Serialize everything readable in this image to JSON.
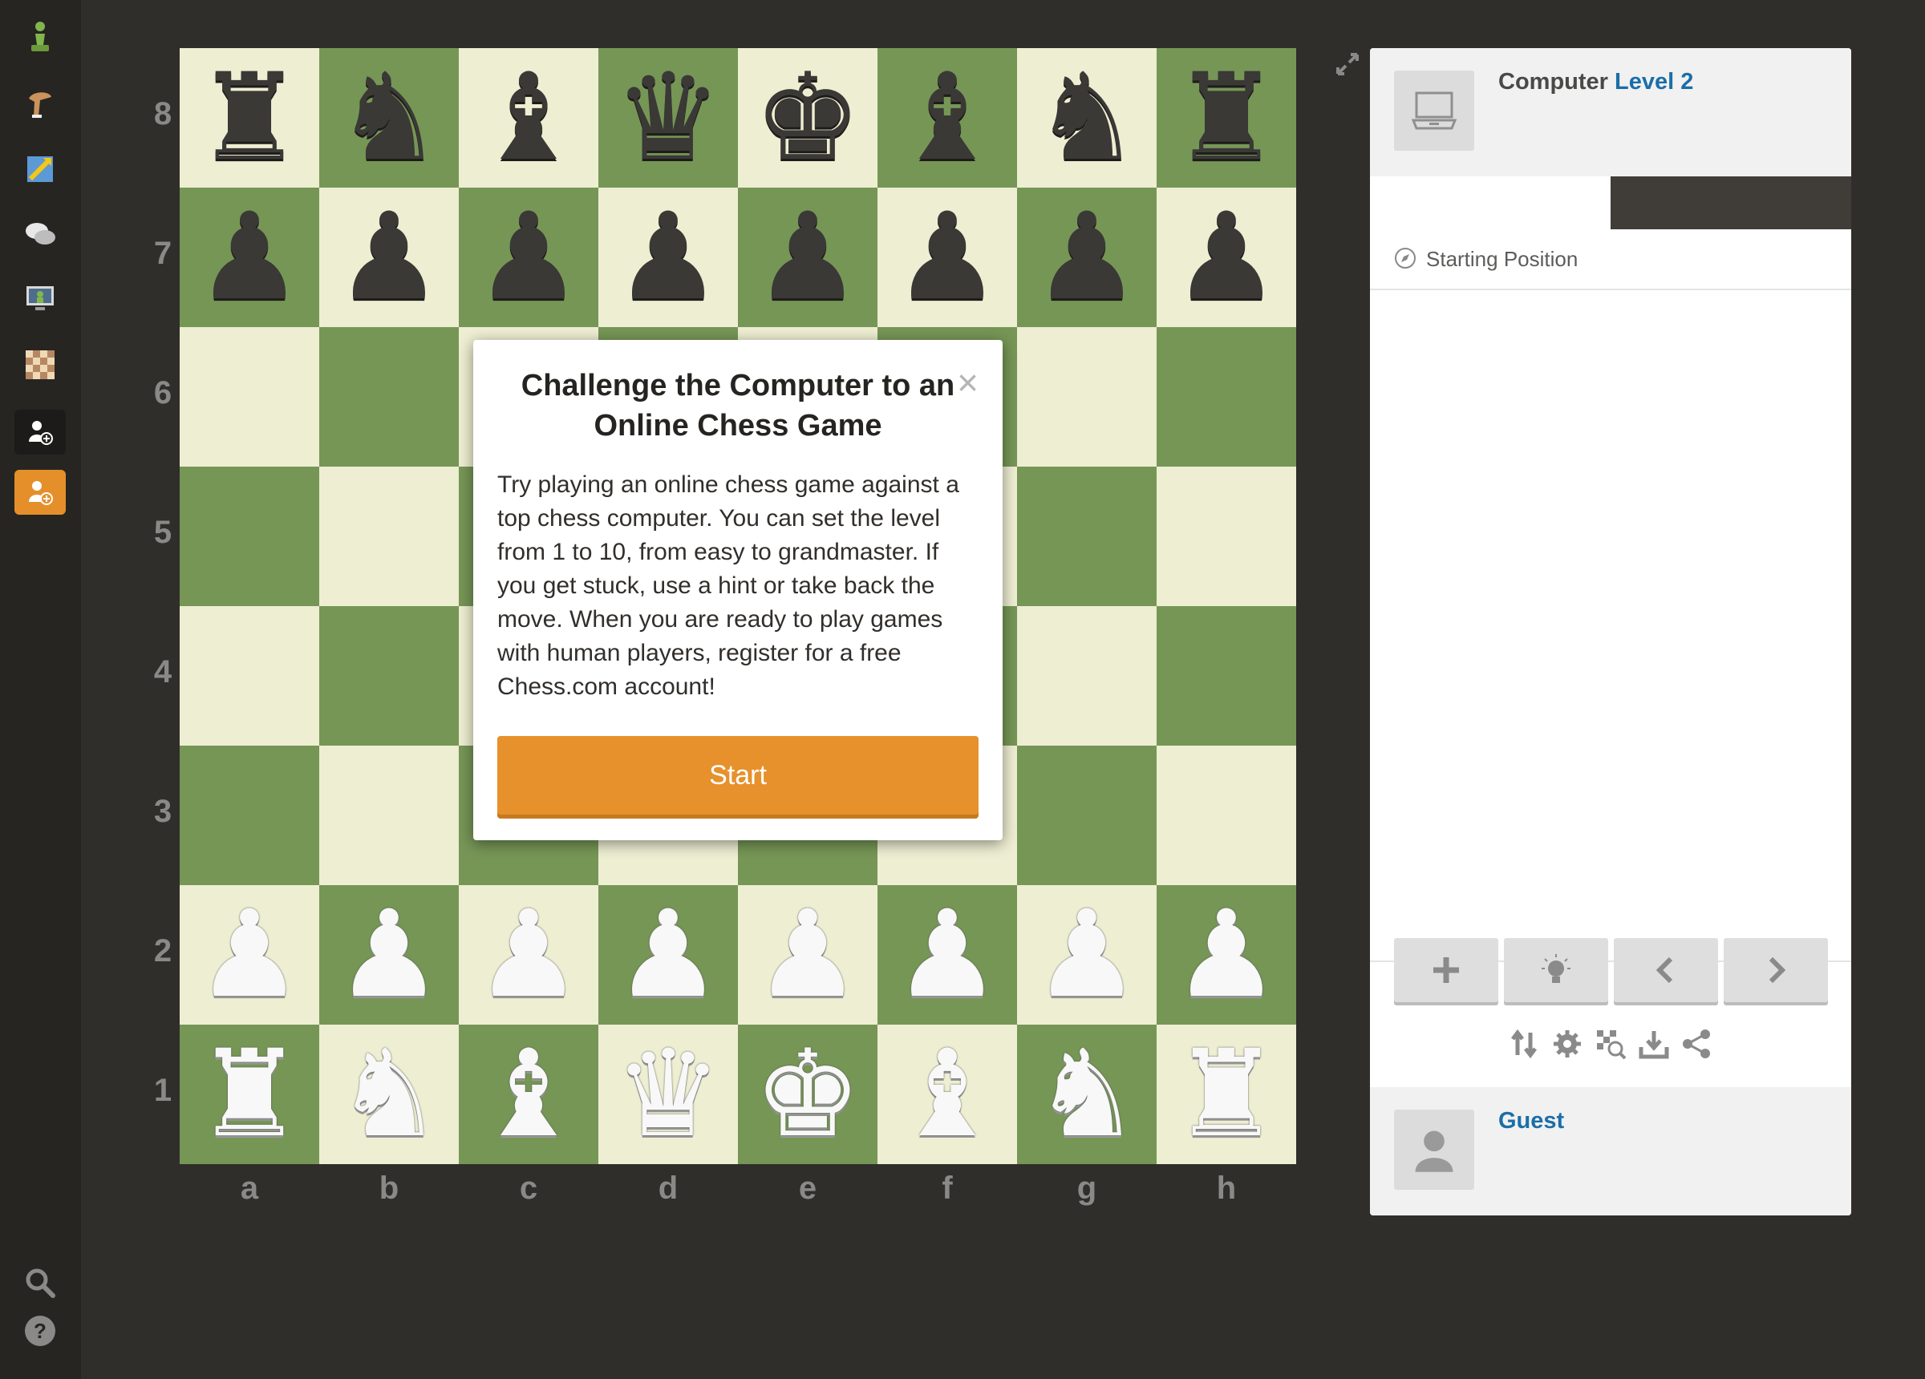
{
  "sidebar": {
    "items": [
      {
        "name": "logo-pawn"
      },
      {
        "name": "play"
      },
      {
        "name": "puzzles"
      },
      {
        "name": "chat"
      },
      {
        "name": "lessons"
      },
      {
        "name": "board-explorer"
      },
      {
        "name": "add-friend"
      },
      {
        "name": "sign-up"
      }
    ],
    "accent_color": "#e58f2a"
  },
  "board": {
    "ranks": [
      "8",
      "7",
      "6",
      "5",
      "4",
      "3",
      "2",
      "1"
    ],
    "files": [
      "a",
      "b",
      "c",
      "d",
      "e",
      "f",
      "g",
      "h"
    ],
    "light_color": "#eeeed2",
    "dark_color": "#769656",
    "position": [
      [
        "r",
        "n",
        "b",
        "q",
        "k",
        "b",
        "n",
        "r"
      ],
      [
        "p",
        "p",
        "p",
        "p",
        "p",
        "p",
        "p",
        "p"
      ],
      [
        "",
        "",
        "",
        "",
        "",
        "",
        "",
        ""
      ],
      [
        "",
        "",
        "",
        "",
        "",
        "",
        "",
        ""
      ],
      [
        "",
        "",
        "",
        "",
        "",
        "",
        "",
        ""
      ],
      [
        "",
        "",
        "",
        "",
        "",
        "",
        "",
        ""
      ],
      [
        "P",
        "P",
        "P",
        "P",
        "P",
        "P",
        "P",
        "P"
      ],
      [
        "R",
        "N",
        "B",
        "Q",
        "K",
        "B",
        "N",
        "R"
      ]
    ]
  },
  "modal": {
    "title": "Challenge the Computer to an Online Chess Game",
    "close": "×",
    "body": "Try playing an online chess game against a top chess computer. You can set the level from 1 to 10, from easy to grandmaster. If you get stuck, use a hint or take back the move. When you are ready to play games with human players, register for a free Chess.com account!",
    "start_label": "Start"
  },
  "panel": {
    "opponent": {
      "name": "Computer",
      "level": "Level 2"
    },
    "starting_position": "Starting Position",
    "controls": [
      "plus-icon",
      "hint-icon",
      "back-icon",
      "forward-icon"
    ],
    "tools": [
      "flip-icon",
      "settings-icon",
      "analysis-icon",
      "download-icon",
      "share-icon"
    ],
    "player": {
      "name": "Guest"
    }
  }
}
